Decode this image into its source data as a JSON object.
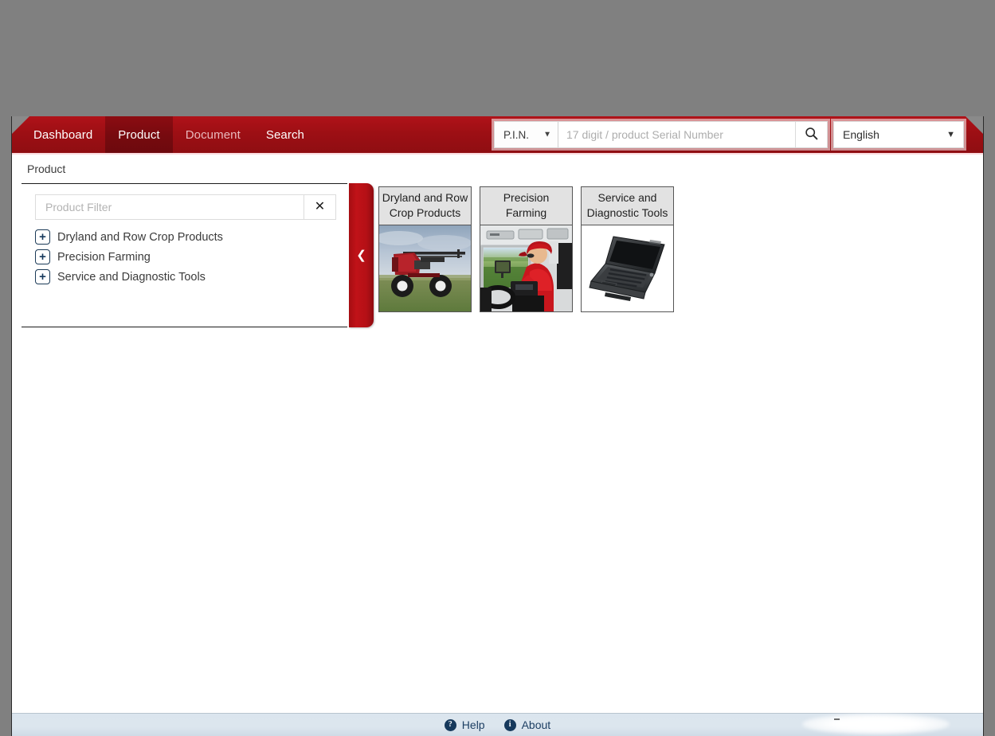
{
  "header": {
    "nav": [
      {
        "label": "Dashboard",
        "active": false,
        "dim": false
      },
      {
        "label": "Product",
        "active": true,
        "dim": false
      },
      {
        "label": "Document",
        "active": false,
        "dim": true
      },
      {
        "label": "Search",
        "active": false,
        "dim": false
      }
    ],
    "search": {
      "type_selected": "P.I.N.",
      "type_options": [
        "P.I.N."
      ],
      "placeholder": "17 digit / product Serial Number",
      "value": "",
      "button_icon": "search-icon"
    },
    "language": {
      "selected": "English",
      "options": [
        "English"
      ]
    },
    "brand_color": "#a6101a",
    "active_tab_color": "#7a0a0f"
  },
  "breadcrumb": {
    "text": "Product"
  },
  "filter_panel": {
    "input_placeholder": "Product Filter",
    "input_value": "",
    "clear_label": "✕",
    "tree": [
      {
        "expander": "+",
        "label": "Dryland and Row Crop Products"
      },
      {
        "expander": "+",
        "label": "Precision Farming"
      },
      {
        "expander": "+",
        "label": "Service and Diagnostic Tools"
      }
    ],
    "collapse_handle_icon": "❮"
  },
  "cards": [
    {
      "title": "Dryland and Row Crop Products",
      "image": "sprayer-photo"
    },
    {
      "title": "Precision Farming",
      "image": "tractor-cab-operator-photo"
    },
    {
      "title": "Service and Diagnostic Tools",
      "image": "rugged-laptop-photo"
    }
  ],
  "footer": {
    "links": [
      {
        "icon": "help-icon",
        "glyph": "?",
        "label": "Help"
      },
      {
        "icon": "about-icon",
        "glyph": "i",
        "label": "About"
      }
    ],
    "background_color": "#dce6ee"
  }
}
